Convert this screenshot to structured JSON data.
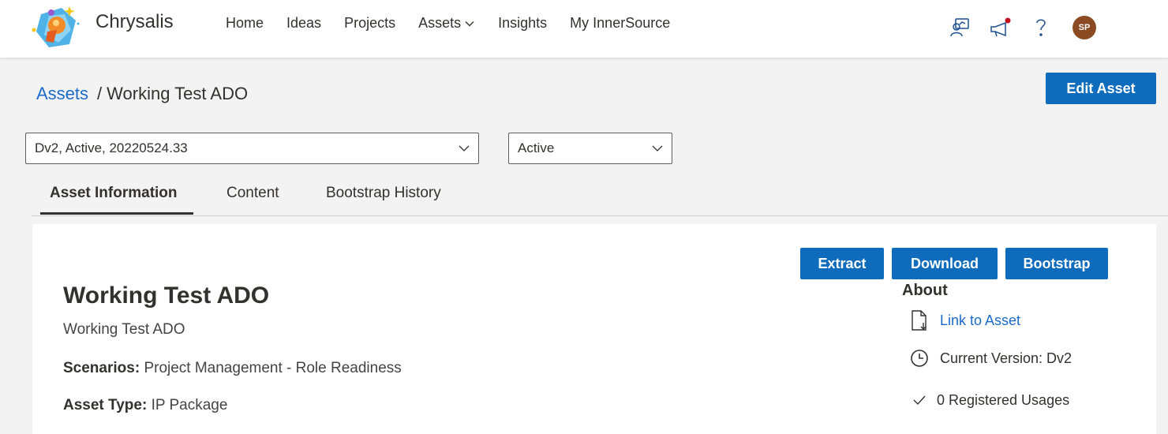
{
  "header": {
    "brand": "Chrysalis",
    "nav": [
      {
        "label": "Home"
      },
      {
        "label": "Ideas"
      },
      {
        "label": "Projects"
      },
      {
        "label": "Assets"
      },
      {
        "label": "Insights"
      },
      {
        "label": "My InnerSource"
      }
    ],
    "avatar_initials": "SP"
  },
  "breadcrumb": {
    "root": "Assets",
    "separator": "/",
    "current": "Working Test ADO"
  },
  "edit_button_label": "Edit Asset",
  "version_select": {
    "value": "Dv2, Active, 20220524.33"
  },
  "status_select": {
    "value": "Active"
  },
  "tabs": [
    {
      "label": "Asset Information"
    },
    {
      "label": "Content"
    },
    {
      "label": "Bootstrap History"
    }
  ],
  "actions": {
    "extract": "Extract",
    "download": "Download",
    "bootstrap": "Bootstrap"
  },
  "asset": {
    "title": "Working Test ADO",
    "description": "Working Test ADO",
    "scenarios_label": "Scenarios:",
    "scenarios_value": "Project Management - Role Readiness",
    "type_label": "Asset Type:",
    "type_value": "IP Package"
  },
  "about": {
    "title": "About",
    "link": "Link to Asset",
    "version": "Current Version: Dv2",
    "usages": "0 Registered Usages"
  },
  "colors": {
    "primary": "#0f6cbd",
    "link": "#1b6ac9",
    "avatar_bg": "#8c4a22",
    "notification_dot": "#c50f1f"
  }
}
